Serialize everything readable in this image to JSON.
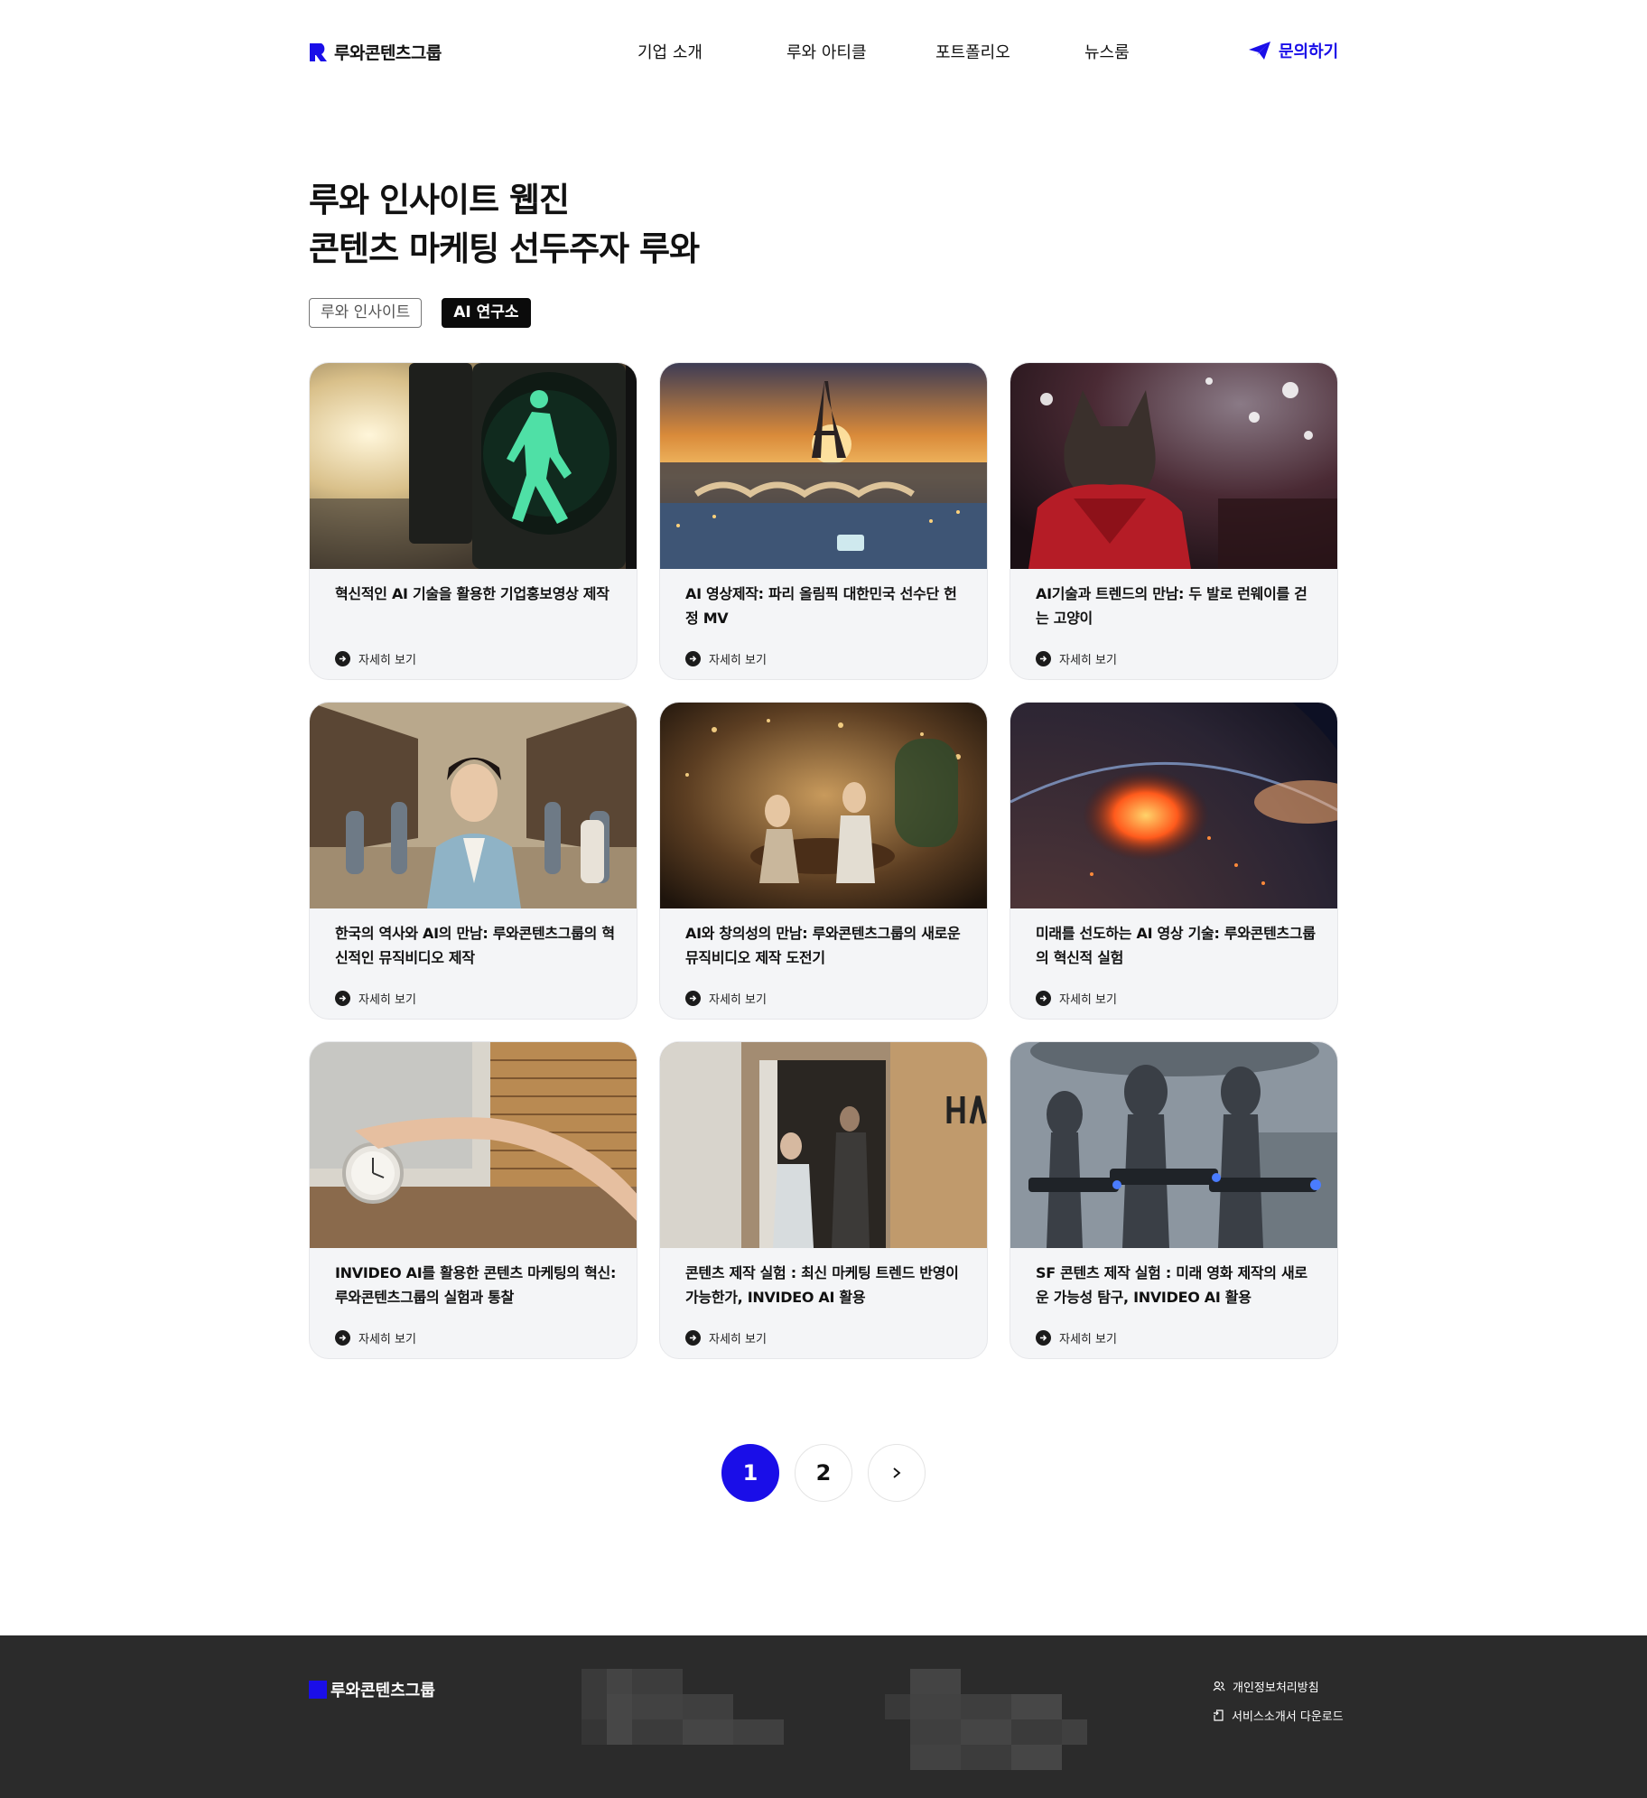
{
  "header": {
    "logo_text": "루와콘텐츠그룹",
    "nav": [
      "기업 소개",
      "루와 아티클",
      "포트폴리오",
      "뉴스룸"
    ],
    "contact_label": "문의하기"
  },
  "hero": {
    "title_line1": "루와 인사이트 웹진",
    "title_line2": "콘텐츠 마케팅 선두주자 루와"
  },
  "tabs": [
    {
      "label": "루와 인사이트",
      "active": false
    },
    {
      "label": "AI 연구소",
      "active": true
    }
  ],
  "more_label": "자세히 보기",
  "cards": [
    {
      "title": "혁신적인 AI 기술을 활용한 기업홍보영상 제작",
      "image": "green-pedestrian-signal"
    },
    {
      "title": "AI 영상제작: 파리 올림픽 대한민국 선수단 헌정 MV",
      "image": "paris-eiffel-tower-sunset"
    },
    {
      "title": "AI기술과 트렌드의 만남: 두 발로 런웨이를 걷는 고양이",
      "image": "cat-in-red-coat"
    },
    {
      "title": "한국의 역사와 AI의 만남: 루와콘텐츠그룹의 혁신적인 뮤직비디오 제작",
      "image": "woman-in-hanbok-street"
    },
    {
      "title": "AI와 창의성의 만남: 루와콘텐츠그룹의 새로운 뮤직비디오 제작 도전기",
      "image": "fantasy-tavern"
    },
    {
      "title": "미래를 선도하는 AI 영상 기술: 루와콘텐츠그룹의 혁신적 실험",
      "image": "burning-planet"
    },
    {
      "title": "INVIDEO AI를 활용한 콘텐츠 마케팅의 혁신: 루와콘텐츠그룹의 실험과 통찰",
      "image": "hand-on-alarm-clock"
    },
    {
      "title": "콘텐츠 제작 실험 : 최신 마케팅 트렌드 반영이 가능한가, INVIDEO AI 활용",
      "image": "zombie-doorway"
    },
    {
      "title": "SF 콘텐츠 제작 실험 : 미래 영화 제작의 새로운 가능성 탐구, INVIDEO AI 활용",
      "image": "aliens-with-guns"
    }
  ],
  "pagination": {
    "pages": [
      "1",
      "2"
    ],
    "current": "1",
    "next_icon": "chevron-right-icon"
  },
  "footer": {
    "logo_text": "루와콘텐츠그룹",
    "links": [
      "개인정보처리방침",
      "서비스소개서 다운로드"
    ]
  },
  "colors": {
    "brand": "#1a0ee8",
    "footer_bg": "#2b2b2b",
    "card_bg": "#f4f5f7"
  }
}
